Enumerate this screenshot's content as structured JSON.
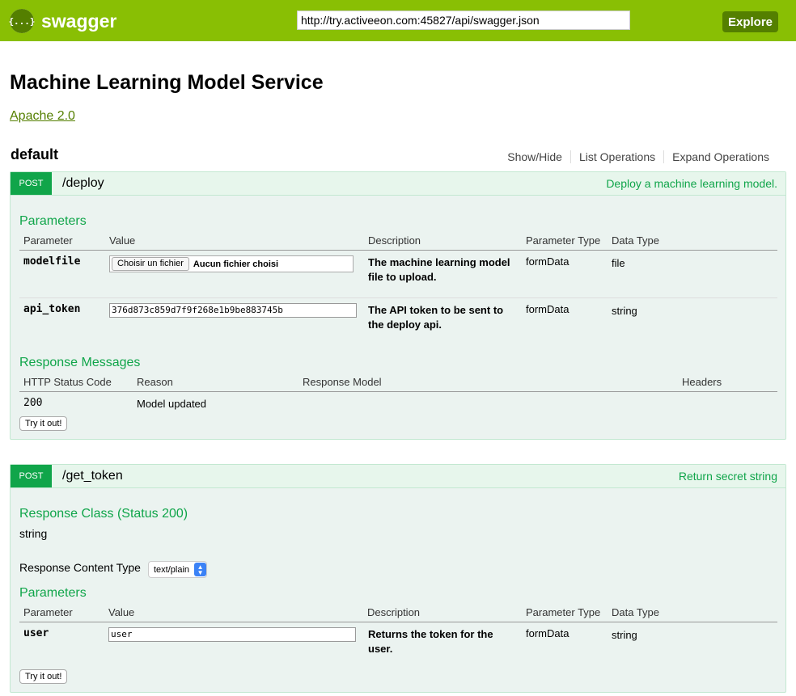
{
  "header": {
    "logo_symbol": "{...}",
    "logo_text": "swagger",
    "url": "http://try.activeeon.com:45827/api/swagger.json",
    "explore_label": "Explore"
  },
  "info": {
    "title": "Machine Learning Model Service",
    "license": "Apache 2.0"
  },
  "section": {
    "name": "default",
    "links": [
      "Show/Hide",
      "List Operations",
      "Expand Operations"
    ]
  },
  "ops": [
    {
      "method": "POST",
      "path": "/deploy",
      "summary": "Deploy a machine learning model.",
      "params_title": "Parameters",
      "param_headers": [
        "Parameter",
        "Value",
        "Description",
        "Parameter Type",
        "Data Type"
      ],
      "params": [
        {
          "name": "modelfile",
          "file_button": "Choisir un fichier",
          "file_text": "Aucun fichier choisi",
          "desc": "The machine learning model file to upload.",
          "ptype": "formData",
          "dtype": "file"
        },
        {
          "name": "api_token",
          "value": "376d873c859d7f9f268e1b9be883745b",
          "desc": "The API token to be sent to the deploy api.",
          "ptype": "formData",
          "dtype": "string"
        }
      ],
      "resp_title": "Response Messages",
      "resp_headers": [
        "HTTP Status Code",
        "Reason",
        "Response Model",
        "Headers"
      ],
      "responses": [
        {
          "code": "200",
          "reason": "Model updated"
        }
      ],
      "try_label": "Try it out!"
    },
    {
      "method": "POST",
      "path": "/get_token",
      "summary": "Return secret string",
      "resp_class_title": "Response Class (Status 200)",
      "resp_class": "string",
      "content_type_label": "Response Content Type",
      "content_type_value": "text/plain",
      "params_title": "Parameters",
      "param_headers": [
        "Parameter",
        "Value",
        "Description",
        "Parameter Type",
        "Data Type"
      ],
      "params": [
        {
          "name": "user",
          "value": "user",
          "desc": "Returns the token for the user.",
          "ptype": "formData",
          "dtype": "string"
        }
      ],
      "try_label": "Try it out!"
    }
  ],
  "colors": {
    "topbar": "#89bf04",
    "post": "#10a54a",
    "explore": "#547f00"
  }
}
